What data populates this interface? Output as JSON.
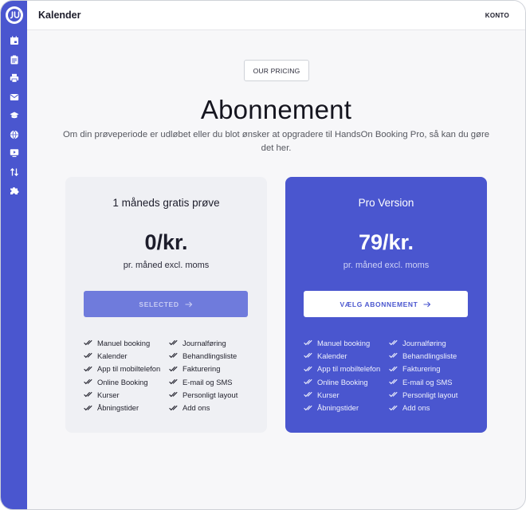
{
  "header": {
    "title": "Kalender",
    "account": "KONTO"
  },
  "sidebar": {
    "items": [
      {
        "icon": "calendar-icon"
      },
      {
        "icon": "clipboard-icon"
      },
      {
        "icon": "printer-icon"
      },
      {
        "icon": "mail-icon"
      },
      {
        "icon": "graduation-cap-icon"
      },
      {
        "icon": "globe-icon"
      },
      {
        "icon": "monitor-play-icon"
      },
      {
        "icon": "swap-vertical-icon"
      },
      {
        "icon": "puzzle-icon"
      }
    ]
  },
  "hero": {
    "chip": "OUR PRICING",
    "title": "Abonnement",
    "description": "Om din prøveperiode er udløbet eller du blot ønsker at opgradere til HandsOn Booking Pro, så kan du gøre det her."
  },
  "plans": {
    "free": {
      "title": "1 måneds gratis prøve",
      "price": "0/kr.",
      "subtitle": "pr. måned excl. moms",
      "button": "SELECTED",
      "features_left": [
        "Manuel booking",
        "Kalender",
        "App til mobiltelefon",
        "Online Booking",
        "Kurser",
        "Åbningstider"
      ],
      "features_right": [
        "Journalføring",
        "Behandlingsliste",
        "Fakturering",
        "E-mail og SMS",
        "Personligt layout",
        "Add ons"
      ]
    },
    "pro": {
      "title": "Pro Version",
      "price": "79/kr.",
      "subtitle": "pr. måned excl. moms",
      "button": "VÆLG ABONNEMENT",
      "features_left": [
        "Manuel booking",
        "Kalender",
        "App til mobiltelefon",
        "Online Booking",
        "Kurser",
        "Åbningstider"
      ],
      "features_right": [
        "Journalføring",
        "Behandlingsliste",
        "Fakturering",
        "E-mail og SMS",
        "Personligt layout",
        "Add ons"
      ]
    }
  },
  "colors": {
    "brand": "#4a56cf",
    "selected_button": "#6f7bdc",
    "page_bg": "#f7f7f9",
    "free_card_bg": "#eff0f4"
  }
}
